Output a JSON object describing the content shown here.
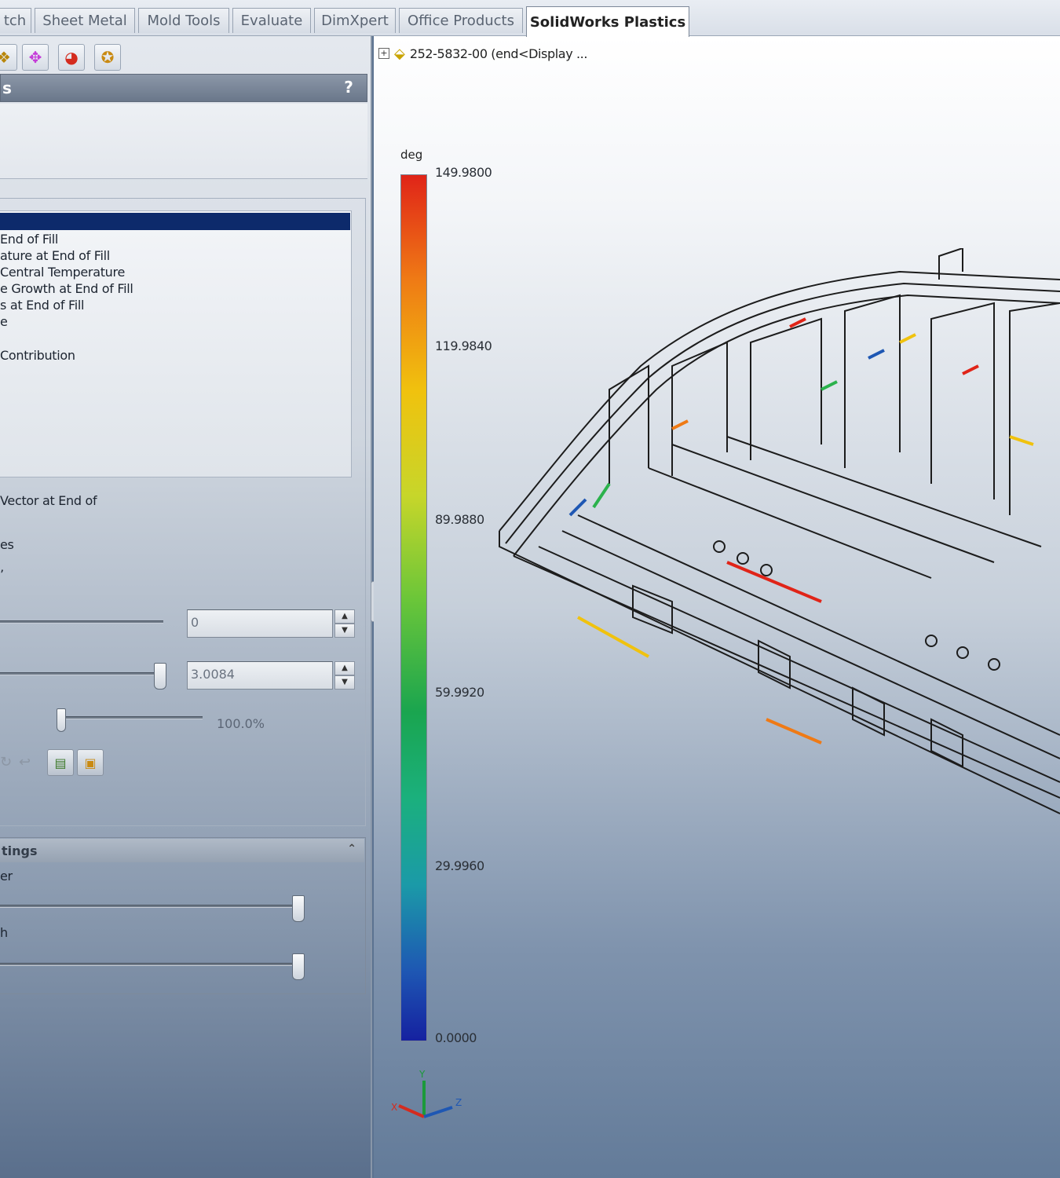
{
  "tabs": [
    {
      "label": "tch"
    },
    {
      "label": "Sheet Metal"
    },
    {
      "label": "Mold Tools"
    },
    {
      "label": "Evaluate"
    },
    {
      "label": "DimXpert"
    },
    {
      "label": "Office Products"
    },
    {
      "label": "SolidWorks Plastics",
      "active": true
    }
  ],
  "property_manager": {
    "title": "s",
    "help": "?",
    "results": [
      "",
      "End of Fill",
      "ature at End of Fill",
      "Central Temperature",
      "e Growth at End of Fill",
      "s at End of Fill",
      "e",
      "Contribution"
    ],
    "labels": {
      "vector": "Vector at End of",
      "es": "es",
      "misc": "’"
    },
    "min_value": "0",
    "max_value": "3.0084",
    "transparency": "100.0%",
    "settings_header": "tings",
    "settings_label_1": "er",
    "settings_label_2": "h"
  },
  "viewport": {
    "tree_label": "252-5832-00  (end<Display ...",
    "legend": {
      "unit": "deg",
      "ticks": [
        "149.9800",
        "119.9840",
        "89.9880",
        "59.9920",
        "29.9960",
        "0.0000"
      ]
    },
    "triad": {
      "x": "X",
      "y": "Y",
      "z": "Z"
    }
  },
  "colors": {
    "scale_top": "#e02418",
    "scale_mid": "#6bc639",
    "scale_bottom": "#1521a0",
    "selection": "#0d2a6b"
  }
}
